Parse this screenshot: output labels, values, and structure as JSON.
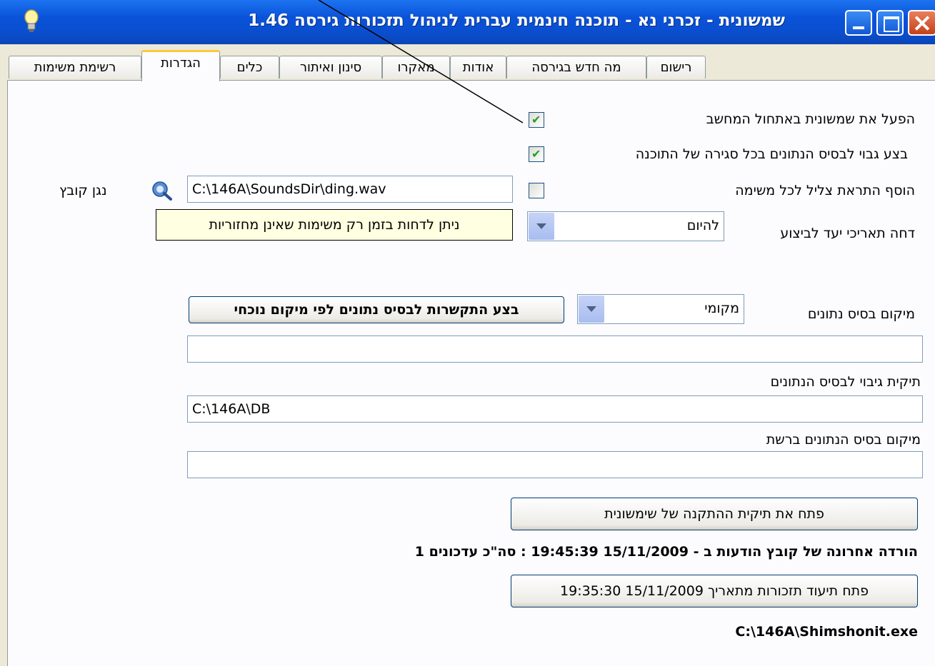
{
  "window": {
    "title": "שמשונית - זכרני נא - תוכנה חינמית עברית לניהול תזכורות גירסה 1.46"
  },
  "tabs": [
    {
      "label": "רישום",
      "active": false
    },
    {
      "label": "מה חדש בגירסה",
      "active": false
    },
    {
      "label": "אודות",
      "active": false
    },
    {
      "label": "מאקרו",
      "active": false
    },
    {
      "label": "סינון ואיתור",
      "active": false
    },
    {
      "label": "כלים",
      "active": false
    },
    {
      "label": "הגדרות",
      "active": true
    },
    {
      "label": "רשימת משימות",
      "active": false
    }
  ],
  "settings": {
    "autostart_label": "הפעל את שמשונית באתחול המחשב",
    "autostart_checked": true,
    "backup_on_close_label": "בצע גבוי לבסיס הנתונים בכל סגירה של התוכנה",
    "backup_on_close_checked": true,
    "sound_alert_label": "הוסף התראת צליל לכל משימה",
    "sound_alert_checked": false,
    "sound_file_label": "נגן קובץ",
    "sound_file_path": "C:\\146A\\SoundsDir\\ding.wav",
    "postpone_label": "דחה תאריכי יעד לביצוע",
    "postpone_value": "להיום",
    "postpone_tooltip": "ניתן לדחות בזמן רק משימות שאינן מחזוריות",
    "db_location_label": "מיקום בסיס נתונים",
    "db_location_value": "מקומי",
    "connect_db_button": "בצע התקשרות לבסיס נתונים לפי מיקום נוכחי",
    "db_location_path": "",
    "backup_folder_label": "תיקית גיבוי לבסיס הנתונים",
    "backup_folder_path": "C:\\146A\\DB",
    "network_db_label": "מיקום בסיס הנתונים ברשת",
    "network_db_path": "",
    "open_install_folder_button": "פתח את תיקית ההתקנה של שימשונית",
    "last_download_text": "הורדה אחרונה של קובץ הודעות ב - 15/11/2009 19:45:39 : סה\"כ עדכונים 1",
    "open_reminders_log_button": "פתח תיעוד תזכורות מתאריך 15/11/2009 19:35:30",
    "exe_path": "C:\\146A\\Shimshonit.exe"
  },
  "icons": {
    "app": "bulb-icon",
    "sound_browse": "sound-search-icon"
  },
  "colors": {
    "titlebar": "#0a52d8",
    "window_bg": "#ece9d8",
    "tooltip_bg": "#ffffe1",
    "check_mark": "#21a121",
    "active_tab_accent": "#ffc83c"
  }
}
